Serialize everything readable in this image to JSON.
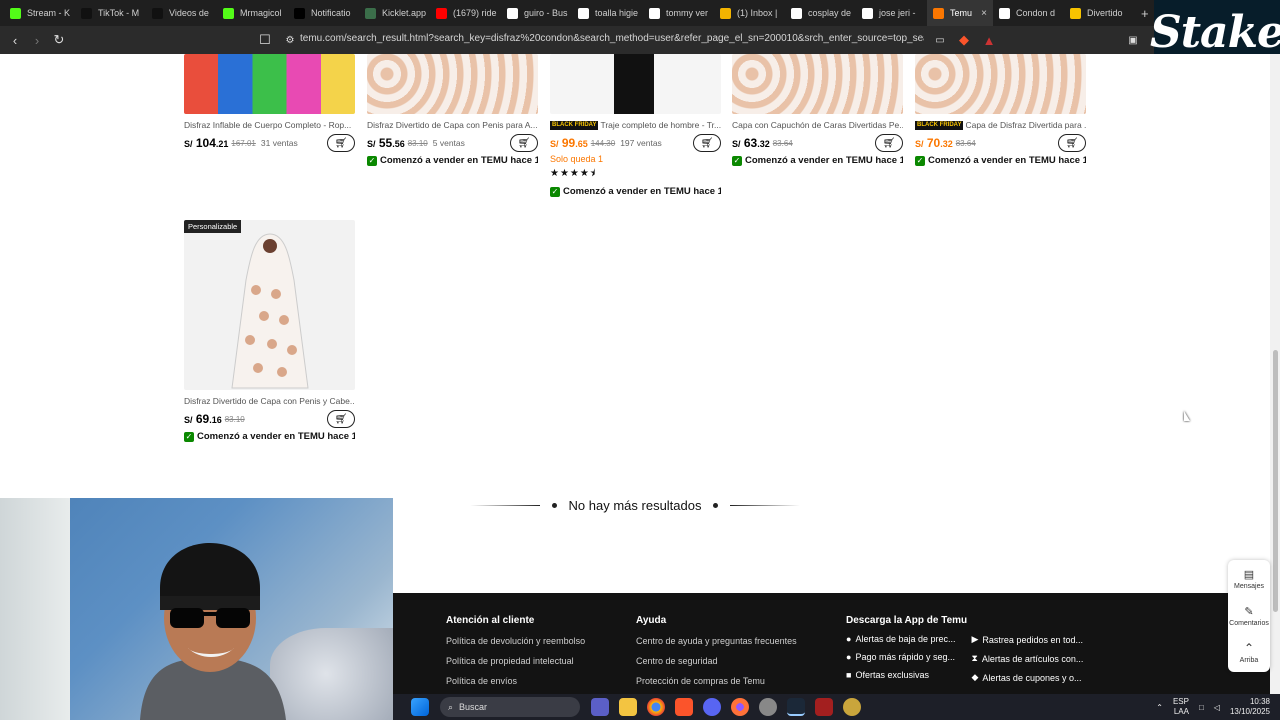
{
  "browser": {
    "tabs": [
      {
        "label": "Stream - K",
        "color": "#53fc18"
      },
      {
        "label": "TikTok - M",
        "color": "#111111"
      },
      {
        "label": "Videos de",
        "color": "#111111"
      },
      {
        "label": "Mrmagicol",
        "color": "#53fc18"
      },
      {
        "label": "Notificatio",
        "color": "#000000"
      },
      {
        "label": "Kicklet.app",
        "color": "#3b6e4a"
      },
      {
        "label": "(1679) ride",
        "color": "#ff0000"
      },
      {
        "label": "guiro - Bus",
        "color": "#ffffff"
      },
      {
        "label": "toalla higie",
        "color": "#ffffff"
      },
      {
        "label": "tommy ver",
        "color": "#ffffff"
      },
      {
        "label": "(1) Inbox |",
        "color": "#f3b400"
      },
      {
        "label": "cosplay de",
        "color": "#ffffff"
      },
      {
        "label": "jose jeri -",
        "color": "#ffffff"
      },
      {
        "label": "Temu",
        "color": "#fb7701",
        "active": true
      },
      {
        "label": "Condon d",
        "color": "#ffffff"
      },
      {
        "label": "Divertido",
        "color": "#f7c300"
      }
    ],
    "new_tab": "+",
    "url": "temu.com/search_result.html?search_key=disfraz%20condon&search_method=user&refer_page_el_sn=200010&srch_enter_source=top_search_entra...",
    "overlay_logo": "Stake"
  },
  "products_row1": [
    {
      "title": "Disfraz Inflable de Cuerpo Completo - Rop...",
      "currency": "S/",
      "price_int": "104",
      "price_dec": ".21",
      "old": "167.01",
      "sold": "31 ventas",
      "seller": "",
      "orange": false,
      "bf": false
    },
    {
      "title": "Disfraz Divertido de Capa con Penis para A...",
      "currency": "S/",
      "price_int": "55",
      "price_dec": ".56",
      "old": "83.10",
      "sold": "5 ventas",
      "seller": "Comenzó a vender en TEMU hace 1...",
      "orange": false,
      "bf": false
    },
    {
      "title": "Traje completo de hombre - Tr...",
      "currency": "S/",
      "price_int": "99",
      "price_dec": ".65",
      "old": "144.30",
      "sold": "197 ventas",
      "stock": "Solo queda 1",
      "rating": "4.5",
      "seller": "Comenzó a vender en TEMU hace 1...",
      "orange": true,
      "bf": true
    },
    {
      "title": "Capa con Capuchón de Caras Divertidas Pe...",
      "currency": "S/",
      "price_int": "63",
      "price_dec": ".32",
      "old": "83.64",
      "sold": "",
      "seller": "Comenzó a vender en TEMU hace 1...",
      "orange": false,
      "bf": false
    },
    {
      "title": "Capa de Disfraz Divertida para ...",
      "currency": "S/",
      "price_int": "70",
      "price_dec": ".32",
      "old": "83.64",
      "sold": "",
      "seller": "Comenzó a vender en TEMU hace 1...",
      "orange": true,
      "bf": true
    }
  ],
  "badges": {
    "black_friday": "BLACK FRIDAY",
    "personalizable": "Personalizable"
  },
  "product_row2": {
    "title": "Disfraz Divertido de Capa con Penis y Cabe...",
    "currency": "S/",
    "price_int": "69",
    "price_dec": ".16",
    "old": "83.10",
    "seller": "Comenzó a vender en TEMU hace 1..."
  },
  "end_message": "No hay más resultados",
  "footer": {
    "col1": {
      "head": "Atención al cliente",
      "links": [
        "Política de devolución y reembolso",
        "Política de propiedad intelectual",
        "Política de envíos"
      ]
    },
    "col2": {
      "head": "Ayuda",
      "links": [
        "Centro de ayuda y preguntas frecuentes",
        "Centro de seguridad",
        "Protección de compras de Temu"
      ]
    },
    "col3": {
      "head": "Descarga la App de Temu",
      "features_left": [
        "Alertas de baja de prec...",
        "Pago más rápido y seg...",
        "Ofertas exclusivas"
      ],
      "features_right": [
        "Rastrea pedidos en tod...",
        "Alertas de artículos con...",
        "Alertas de cupones y o..."
      ]
    }
  },
  "side_widget": {
    "messages": "Mensajes",
    "comments": "Comentarios",
    "top": "Arriba"
  },
  "taskbar": {
    "search": "Buscar",
    "lang": "ESP",
    "lang2": "LAA",
    "time": "10:38",
    "date": "13/10/2025"
  }
}
